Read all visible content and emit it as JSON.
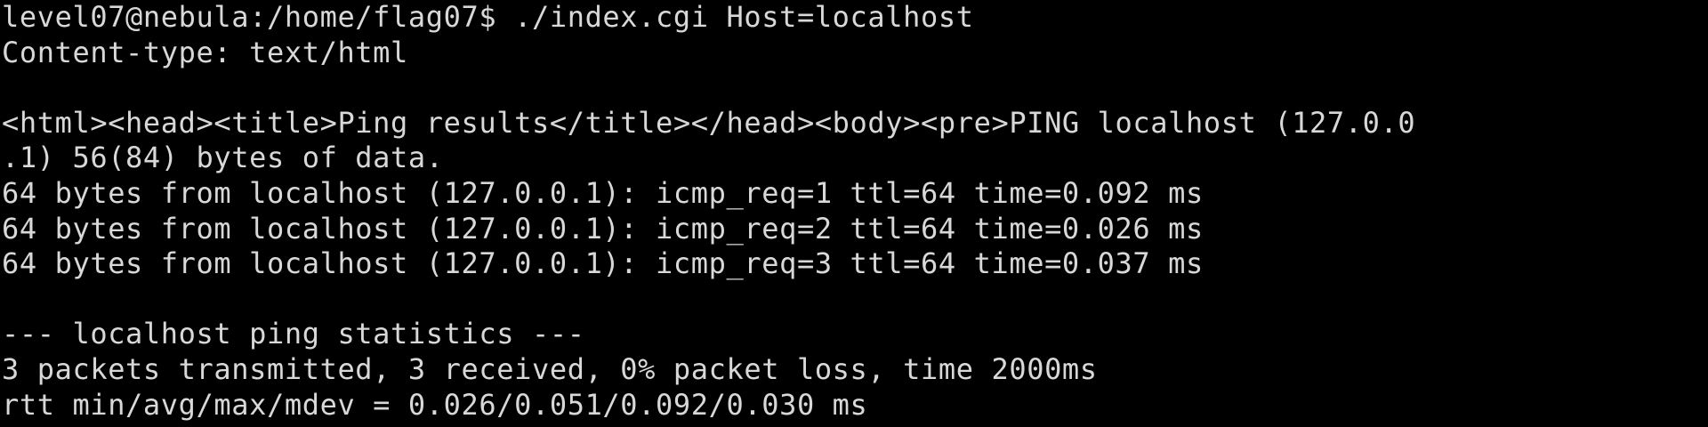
{
  "terminal": {
    "lines": [
      "level07@nebula:/home/flag07$ ./index.cgi Host=localhost",
      "Content-type: text/html",
      "",
      "<html><head><title>Ping results</title></head><body><pre>PING localhost (127.0.0",
      ".1) 56(84) bytes of data.",
      "64 bytes from localhost (127.0.0.1): icmp_req=1 ttl=64 time=0.092 ms",
      "64 bytes from localhost (127.0.0.1): icmp_req=2 ttl=64 time=0.026 ms",
      "64 bytes from localhost (127.0.0.1): icmp_req=3 ttl=64 time=0.037 ms",
      "",
      "--- localhost ping statistics ---",
      "3 packets transmitted, 3 received, 0% packet loss, time 2000ms",
      "rtt min/avg/max/mdev = 0.026/0.051/0.092/0.030 ms"
    ]
  }
}
